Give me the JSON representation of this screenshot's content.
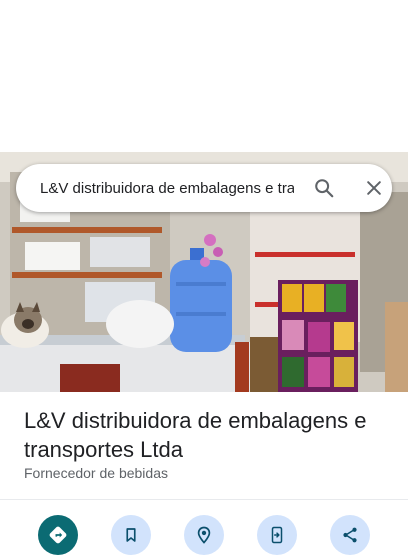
{
  "search": {
    "query": "L&V distribuidora de embalagens e transportes Ltda"
  },
  "place": {
    "name": "L&V distribuidora de embalagens e transportes Ltda",
    "category": "Fornecedor de bebidas"
  },
  "colors": {
    "primary_action": "#0b6b73",
    "secondary_action": "#d2e3fc",
    "icon_dark": "#0b4f6c"
  },
  "actions": [
    {
      "icon": "directions-icon"
    },
    {
      "icon": "bookmark-icon"
    },
    {
      "icon": "nearby-icon"
    },
    {
      "icon": "send-to-phone-icon"
    },
    {
      "icon": "share-icon"
    }
  ]
}
